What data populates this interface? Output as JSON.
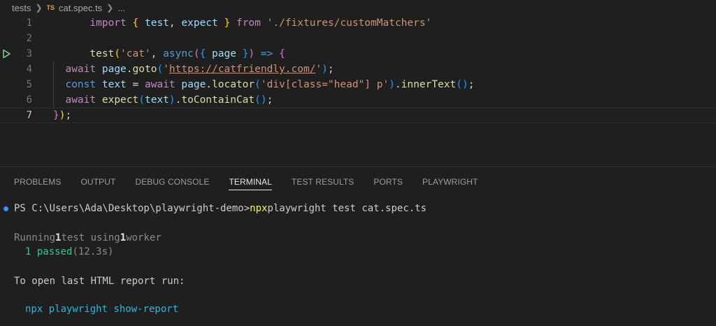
{
  "breadcrumb": {
    "folder": "tests",
    "file_badge": "TS",
    "file": "cat.spec.ts",
    "ellipsis": "..."
  },
  "editor": {
    "line_numbers": [
      "1",
      "2",
      "3",
      "4",
      "5",
      "6",
      "7"
    ],
    "line1": {
      "import": "import",
      "ob": "{",
      "test": "test",
      "comma": ",",
      "expect": "expect",
      "cb": "}",
      "from": "from",
      "path": "'./fixtures/customMatchers'"
    },
    "line3": {
      "test": "test",
      "op": "(",
      "name": "'cat'",
      "comma": ",",
      "async": "async",
      "op2": "(",
      "ob": "{",
      "page": "page",
      "cb": "}",
      "cp2": ")",
      "arrow": "=>",
      "brace": "{"
    },
    "line4": {
      "await": "await",
      "page": "page",
      "dot": ".",
      "goto": "goto",
      "op": "(",
      "q1": "'",
      "url": "https://catfriendly.com/",
      "q2": "'",
      "cp": ")",
      "semi": ";"
    },
    "line5": {
      "const": "const",
      "text": "text",
      "eq": "=",
      "await": "await",
      "page": "page",
      "dot": ".",
      "locator": "locator",
      "op": "(",
      "sel": "'div[class=\"head\"] p'",
      "cp": ")",
      "dot2": ".",
      "inner": "innerText",
      "call": "()",
      "semi": ";"
    },
    "line6": {
      "await": "await",
      "expect": "expect",
      "op": "(",
      "text": "text",
      "cp": ")",
      "dot": ".",
      "matcher": "toContainCat",
      "call": "()",
      "semi": ";"
    },
    "line7": {
      "cb": "}",
      "cp": ")",
      "semi": ";"
    }
  },
  "panel": {
    "tabs": [
      "PROBLEMS",
      "OUTPUT",
      "DEBUG CONSOLE",
      "TERMINAL",
      "TEST RESULTS",
      "PORTS",
      "PLAYWRIGHT"
    ],
    "active_tab": "TERMINAL"
  },
  "terminal": {
    "prompt": "PS C:\\Users\\Ada\\Desktop\\playwright-demo>",
    "cmd_npx": "npx",
    "cmd_rest": "playwright test cat.spec.ts",
    "running_a": "Running",
    "running_n1": "1",
    "running_b": "test using",
    "running_n2": "1",
    "running_c": "worker",
    "passed": "1 passed",
    "duration": "(12.3s)",
    "report_hint": "To open last HTML report run:",
    "report_cmd": "npx playwright show-report"
  },
  "colors": {
    "accent": "#3794ff",
    "run_glyph": "#89d185",
    "background": "#1f1f1f"
  }
}
